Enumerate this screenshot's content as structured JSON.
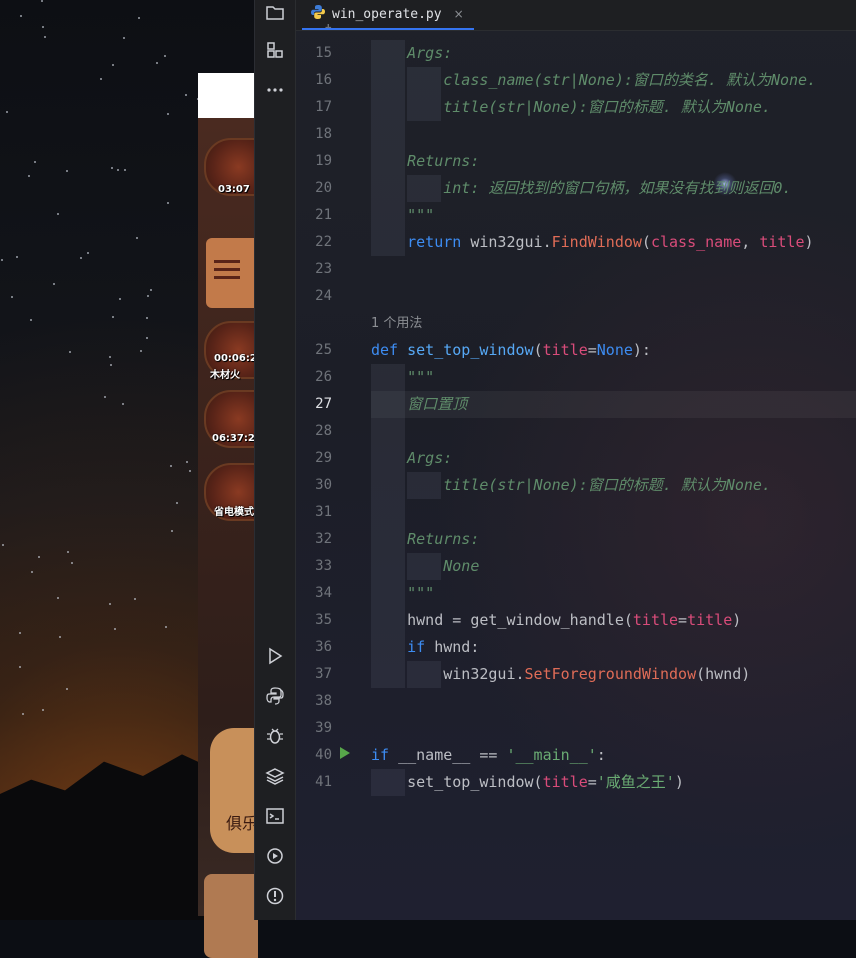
{
  "ide": {
    "tab": {
      "filename": "win_operate.py",
      "close_glyph": "×"
    },
    "current_line": 27,
    "lines": [
      {
        "no": "15",
        "segments": [
          [
            "doc",
            "Args:"
          ]
        ],
        "indent": 1
      },
      {
        "no": "16",
        "segments": [
          [
            "doc",
            "class_name(str|None):窗口的类名. 默认为None."
          ]
        ],
        "indent": 2
      },
      {
        "no": "17",
        "segments": [
          [
            "doc",
            "title(str|None):窗口的标题. 默认为None."
          ]
        ],
        "indent": 2
      },
      {
        "no": "18",
        "segments": [],
        "indent": 1
      },
      {
        "no": "19",
        "segments": [
          [
            "doc",
            "Returns:"
          ]
        ],
        "indent": 1
      },
      {
        "no": "20",
        "segments": [
          [
            "doc",
            "int: 返回找到的窗口句柄，如果没有找到则返回0."
          ]
        ],
        "indent": 2
      },
      {
        "no": "21",
        "segments": [
          [
            "doc",
            "\"\"\""
          ]
        ],
        "indent": 1
      },
      {
        "no": "22",
        "segments": [
          [
            "kw2",
            "return "
          ],
          [
            "plain",
            "win32gui."
          ],
          [
            "call",
            "FindWindow"
          ],
          [
            "plain",
            "("
          ],
          [
            "param",
            "class_name"
          ],
          [
            "plain",
            ", "
          ],
          [
            "param",
            "title"
          ],
          [
            "plain",
            ")"
          ]
        ],
        "indent": 1
      },
      {
        "no": "23",
        "segments": [],
        "indent": 0
      },
      {
        "no": "24",
        "segments": [],
        "indent": 0
      },
      {
        "no": "25",
        "segments": [
          [
            "def",
            "def "
          ],
          [
            "fn",
            "set_top_window"
          ],
          [
            "plain",
            "("
          ],
          [
            "param",
            "title"
          ],
          [
            "plain",
            "="
          ],
          [
            "kw2",
            "None"
          ],
          [
            "plain",
            "):"
          ]
        ],
        "indent": 0,
        "inlay": "1 个用法"
      },
      {
        "no": "26",
        "segments": [
          [
            "doc",
            "\"\"\""
          ]
        ],
        "indent": 1
      },
      {
        "no": "27",
        "segments": [
          [
            "doc",
            "窗口置顶"
          ]
        ],
        "indent": 1
      },
      {
        "no": "28",
        "segments": [],
        "indent": 1
      },
      {
        "no": "29",
        "segments": [
          [
            "doc",
            "Args:"
          ]
        ],
        "indent": 1
      },
      {
        "no": "30",
        "segments": [
          [
            "doc",
            "title(str|None):窗口的标题. 默认为None."
          ]
        ],
        "indent": 2
      },
      {
        "no": "31",
        "segments": [],
        "indent": 1
      },
      {
        "no": "32",
        "segments": [
          [
            "doc",
            "Returns:"
          ]
        ],
        "indent": 1
      },
      {
        "no": "33",
        "segments": [
          [
            "doc",
            "None"
          ]
        ],
        "indent": 2
      },
      {
        "no": "34",
        "segments": [
          [
            "doc",
            "\"\"\""
          ]
        ],
        "indent": 1
      },
      {
        "no": "35",
        "segments": [
          [
            "plain",
            "hwnd = get_window_handle("
          ],
          [
            "param",
            "title"
          ],
          [
            "plain",
            "="
          ],
          [
            "param",
            "title"
          ],
          [
            "plain",
            ")"
          ]
        ],
        "indent": 1
      },
      {
        "no": "36",
        "segments": [
          [
            "kw2",
            "if "
          ],
          [
            "plain",
            "hwnd:"
          ]
        ],
        "indent": 1
      },
      {
        "no": "37",
        "segments": [
          [
            "plain",
            "win32gui."
          ],
          [
            "call",
            "SetForegroundWindow"
          ],
          [
            "plain",
            "(hwnd)"
          ]
        ],
        "indent": 2
      },
      {
        "no": "38",
        "segments": [],
        "indent": 0
      },
      {
        "no": "39",
        "segments": [],
        "indent": 0
      },
      {
        "no": "40",
        "segments": [
          [
            "kw2",
            "if "
          ],
          [
            "plain",
            "__name__ == "
          ],
          [
            "str",
            "'__main__'"
          ],
          [
            "plain",
            ":"
          ]
        ],
        "indent": 0,
        "run": true
      },
      {
        "no": "41",
        "segments": [
          [
            "plain",
            "set_top_window("
          ],
          [
            "param",
            "title"
          ],
          [
            "plain",
            "="
          ],
          [
            "str",
            "'咸鱼之王'"
          ],
          [
            "plain",
            ")"
          ]
        ],
        "indent": 1
      }
    ],
    "top_partial_line_no": "1",
    "sidebar_icons_top": [
      "folder-icon",
      "structure-icon",
      "more-icon"
    ],
    "sidebar_icons_bottom": [
      "run-icon",
      "python-console-icon",
      "debug-icon",
      "layers-icon",
      "terminal-icon",
      "services-icon",
      "problems-icon"
    ]
  },
  "game": {
    "labels": [
      "03:07",
      "00:06:2",
      "木材火",
      "06:37:2",
      "省电模式",
      "俱乐"
    ]
  },
  "colors": {
    "ide_bg": "#1f2129",
    "accent": "#3574f0",
    "docstring": "#5f8c6a",
    "keyword": "#3d8cf2",
    "param": "#d94c7a",
    "string": "#6aab73"
  }
}
